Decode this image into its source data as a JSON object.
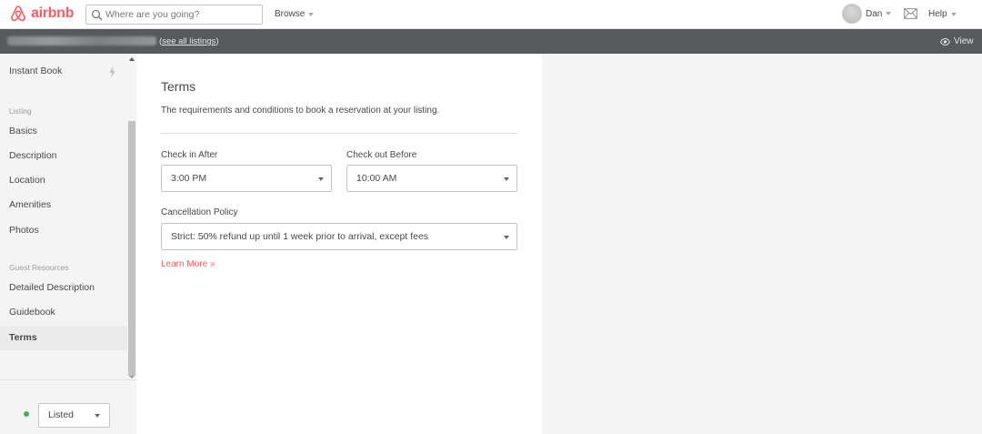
{
  "header": {
    "logo_text": "airbnb",
    "search": {
      "placeholder": "Where are you going?",
      "value": ""
    },
    "browse_label": "Browse",
    "user_name": "Dan",
    "help_label": "Help"
  },
  "subheader": {
    "see_all_label": "see all listings",
    "view_label": "View"
  },
  "sidebar": {
    "items": [
      {
        "label": "Instant Book"
      },
      {
        "label": "Basics"
      },
      {
        "label": "Description"
      },
      {
        "label": "Location"
      },
      {
        "label": "Amenities"
      },
      {
        "label": "Photos"
      },
      {
        "label": "Detailed Description"
      },
      {
        "label": "Guidebook"
      },
      {
        "label": "Terms"
      }
    ],
    "sections": {
      "listing": "Listing",
      "guest_resources": "Guest Resources"
    },
    "status": {
      "value": "Listed",
      "color": "#3fb34f"
    }
  },
  "main": {
    "title": "Terms",
    "description": "The requirements and conditions to book a reservation at your listing.",
    "check_in": {
      "label": "Check in After",
      "value": "3:00 PM"
    },
    "check_out": {
      "label": "Check out Before",
      "value": "10:00 AM"
    },
    "cancellation": {
      "label": "Cancellation Policy",
      "value": "Strict: 50% refund up until 1 week prior to arrival, except fees"
    },
    "learn_more": "Learn More »"
  },
  "colors": {
    "brand": "#ff5a5f",
    "subheader_bg": "#565a5c",
    "sidebar_bg": "#f4f4f4"
  }
}
